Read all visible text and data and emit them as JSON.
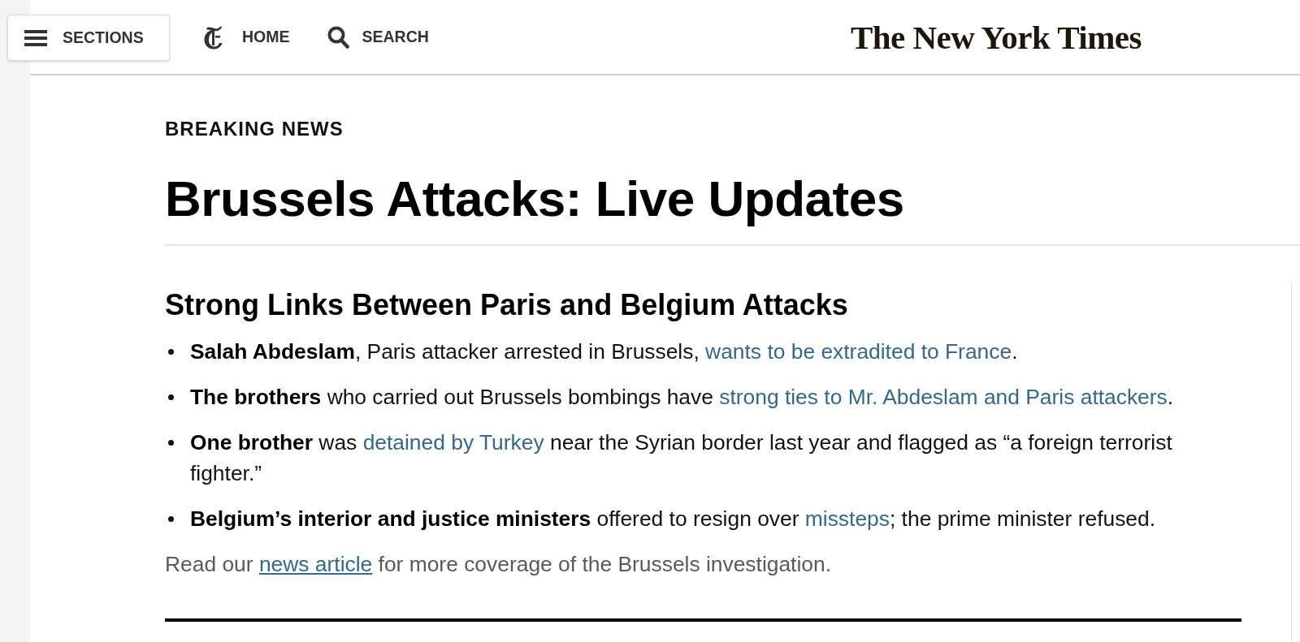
{
  "header": {
    "sections_button": "SECTIONS",
    "home_link": "HOME",
    "search_button": "SEARCH",
    "logo": "The New York Times"
  },
  "kicker": "BREAKING NEWS",
  "headline": "Brussels Attacks: Live Updates",
  "summary": {
    "heading": "Strong Links Between Paris and Belgium Attacks",
    "bullets": [
      {
        "parts": [
          {
            "kind": "bold",
            "text": "Salah Abdeslam"
          },
          {
            "kind": "text",
            "text": ", Paris attacker arrested in Brussels, "
          },
          {
            "kind": "link",
            "text": "wants to be extradited to France"
          },
          {
            "kind": "text",
            "text": "."
          }
        ]
      },
      {
        "parts": [
          {
            "kind": "bold",
            "text": "The brothers"
          },
          {
            "kind": "text",
            "text": " who carried out Brussels bombings have "
          },
          {
            "kind": "link",
            "text": "strong ties to Mr. Abdeslam and Paris attackers"
          },
          {
            "kind": "text",
            "text": "."
          }
        ]
      },
      {
        "parts": [
          {
            "kind": "bold",
            "text": "One brother"
          },
          {
            "kind": "text",
            "text": " was "
          },
          {
            "kind": "link",
            "text": "detained by Turkey"
          },
          {
            "kind": "text",
            "text": " near the Syrian border last year and flagged as “a foreign terrorist fighter.”"
          }
        ]
      },
      {
        "parts": [
          {
            "kind": "bold",
            "text": "Belgium’s interior and justice ministers"
          },
          {
            "kind": "text",
            "text": " offered to resign over "
          },
          {
            "kind": "link",
            "text": "missteps"
          },
          {
            "kind": "text",
            "text": "; the prime minister refused."
          }
        ]
      }
    ],
    "footnote": {
      "parts": [
        {
          "kind": "text",
          "text": "Read our "
        },
        {
          "kind": "link",
          "text": "news article"
        },
        {
          "kind": "text",
          "text": " for more coverage of the Brussels investigation."
        }
      ]
    }
  }
}
